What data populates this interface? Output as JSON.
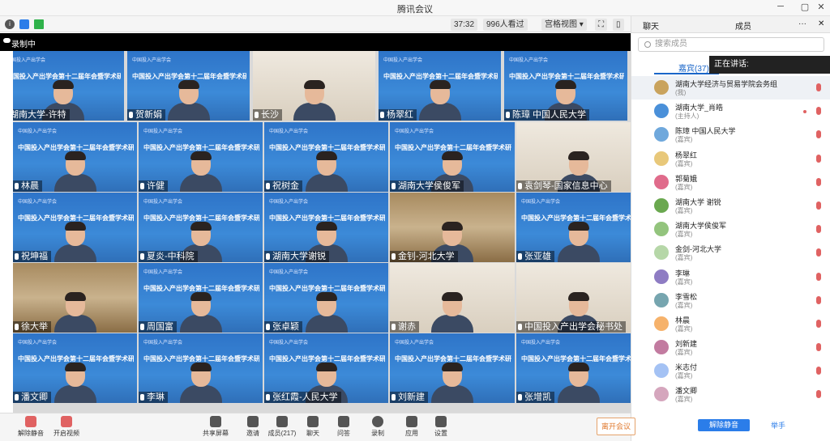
{
  "window": {
    "title": "腾讯会议"
  },
  "toolbar": {
    "timer": "37:32",
    "viewers": "996人看过",
    "view_mode": "宫格视图"
  },
  "recording": {
    "label": "录制中"
  },
  "top_strip": [
    {
      "name": "湖南大学-许特"
    },
    {
      "name": "贺新娟"
    },
    {
      "name": "长沙"
    },
    {
      "name": "杨翠红"
    },
    {
      "name": "陈璋 中国人民大学"
    }
  ],
  "slide": {
    "title": "中国投入产出学会第十二届年会暨学术研讨会",
    "logo": "中国投入产出学会"
  },
  "grid": [
    {
      "name": "林晨",
      "bg": "slide"
    },
    {
      "name": "许健",
      "bg": "slide"
    },
    {
      "name": "祝树金",
      "bg": "slide"
    },
    {
      "name": "湖南大学侯俊军",
      "bg": "slide"
    },
    {
      "name": "袁剑琴-国家信息中心",
      "bg": "room"
    },
    {
      "name": "祝坤福",
      "bg": "slide"
    },
    {
      "name": "夏炎-中科院",
      "bg": "slide"
    },
    {
      "name": "湖南大学谢锐",
      "bg": "slide"
    },
    {
      "name": "金钊-河北大学",
      "bg": "shelf"
    },
    {
      "name": "张亚雄",
      "bg": "slide"
    },
    {
      "name": "徐大举",
      "bg": "shelf"
    },
    {
      "name": "周国富",
      "bg": "slide"
    },
    {
      "name": "张卓颖",
      "bg": "slide"
    },
    {
      "name": "谢赤",
      "bg": "room"
    },
    {
      "name": "中国投入产出学会秘书处",
      "bg": "room"
    },
    {
      "name": "潘文卿",
      "bg": "slide"
    },
    {
      "name": "李琳",
      "bg": "slide"
    },
    {
      "name": "张红霞-人民大学",
      "bg": "slide"
    },
    {
      "name": "刘新建",
      "bg": "slide"
    },
    {
      "name": "张增凯",
      "bg": "slide"
    }
  ],
  "panel": {
    "tab_chat": "聊天",
    "tab_members": "成员",
    "search_placeholder": "搜索成员",
    "guests_tab": "嘉宾(37)",
    "speaking_label": "正在讲话:",
    "top_entry": {
      "name": "湖南大学经济与贸易学院会务组",
      "role": "(我)"
    },
    "members": [
      {
        "name": "湖南大学_肖皓",
        "role": "(主持人)",
        "color": "#4a90d9"
      },
      {
        "name": "陈璋 中国人民大学",
        "role": "(嘉宾)",
        "color": "#6fa8dc"
      },
      {
        "name": "杨翠红",
        "role": "(嘉宾)",
        "color": "#e8c87a"
      },
      {
        "name": "郭菊娥",
        "role": "(嘉宾)",
        "color": "#e06b8b"
      },
      {
        "name": "湖南大学 谢锐",
        "role": "(嘉宾)",
        "color": "#6aa84f"
      },
      {
        "name": "湖南大学侯俊军",
        "role": "(嘉宾)",
        "color": "#93c47d"
      },
      {
        "name": "金剑-河北大学",
        "role": "(嘉宾)",
        "color": "#b6d7a8"
      },
      {
        "name": "李琳",
        "role": "(嘉宾)",
        "color": "#8e7cc3"
      },
      {
        "name": "李雪松",
        "role": "(嘉宾)",
        "color": "#76a5af"
      },
      {
        "name": "林晨",
        "role": "(嘉宾)",
        "color": "#f6b26b"
      },
      {
        "name": "刘新建",
        "role": "(嘉宾)",
        "color": "#c27ba0"
      },
      {
        "name": "米志付",
        "role": "(嘉宾)",
        "color": "#a4c2f4"
      },
      {
        "name": "潘文卿",
        "role": "(嘉宾)",
        "color": "#d5a6bd"
      }
    ],
    "unmute_all": "解除静音",
    "raise_hand": "举手"
  },
  "bottombar": {
    "unmute": "解除静音",
    "start_video": "开启视频",
    "share_screen": "共享屏幕",
    "invite": "邀请",
    "members": "成员(217)",
    "chat": "聊天",
    "qa": "问答",
    "record": "录制",
    "apps": "应用",
    "settings": "设置",
    "leave": "离开会议"
  }
}
